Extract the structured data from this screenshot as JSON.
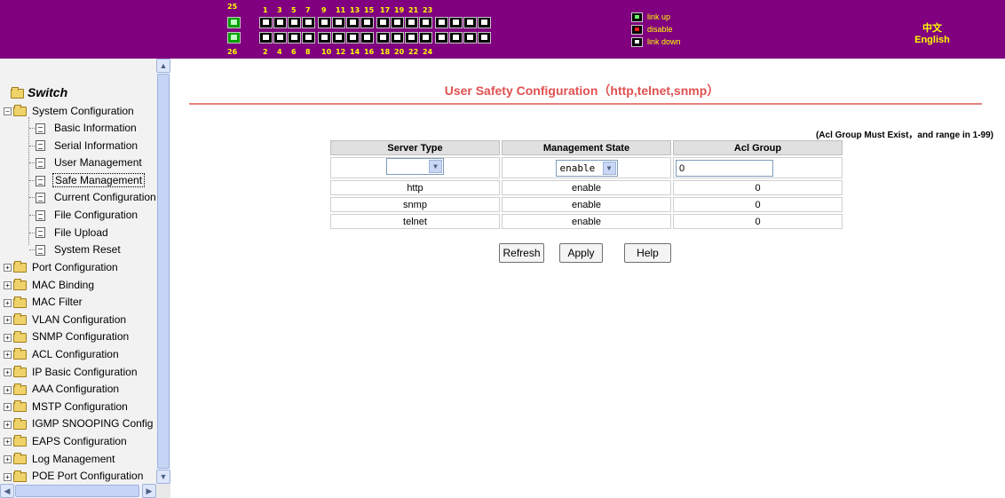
{
  "header": {
    "port_numbers": {
      "top_odd": [
        "1",
        "3",
        "5",
        "7",
        "9",
        "11",
        "13",
        "15",
        "17",
        "19",
        "21",
        "23"
      ],
      "bottom_even": [
        "2",
        "4",
        "6",
        "8",
        "10",
        "12",
        "14",
        "16",
        "18",
        "20",
        "22",
        "24"
      ],
      "uplink_top": "25",
      "uplink_bottom": "26"
    },
    "legend": {
      "link_up": "link up",
      "disable": "disable",
      "link_down": "link down"
    },
    "lang_chinese": "中文",
    "lang_english": "English",
    "colors": {
      "background": "#800080",
      "text": "#ffff00"
    }
  },
  "sidebar": {
    "root": "Switch",
    "system_configuration": {
      "label": "System Configuration",
      "children": [
        "Basic Information",
        "Serial Information",
        "User Management",
        "Safe Management",
        "Current Configuration",
        "File Configuration",
        "File Upload",
        "System Reset"
      ],
      "selected": "Safe Management"
    },
    "folders": [
      "Port Configuration",
      "MAC Binding",
      "MAC Filter",
      "VLAN Configuration",
      "SNMP Configuration",
      "ACL Configuration",
      "IP Basic Configuration",
      "AAA Configuration",
      "MSTP Configuration",
      "IGMP SNOOPING Config",
      "EAPS Configuration",
      "Log Management",
      "POE Port Configuration"
    ]
  },
  "main": {
    "title": "User Safety Configuration（http,telnet,snmp）",
    "note": "(Acl Group Must Exist，and range in 1-99)",
    "table": {
      "headers": [
        "Server Type",
        "Management State",
        "Acl Group"
      ],
      "edit_row": {
        "server_type": "",
        "management_state": "enable",
        "acl_group": "0"
      },
      "rows": [
        [
          "http",
          "enable",
          "0"
        ],
        [
          "snmp",
          "enable",
          "0"
        ],
        [
          "telnet",
          "enable",
          "0"
        ]
      ]
    },
    "buttons": {
      "refresh": "Refresh",
      "apply": "Apply",
      "help": "Help"
    },
    "title_color": "#e05050"
  }
}
